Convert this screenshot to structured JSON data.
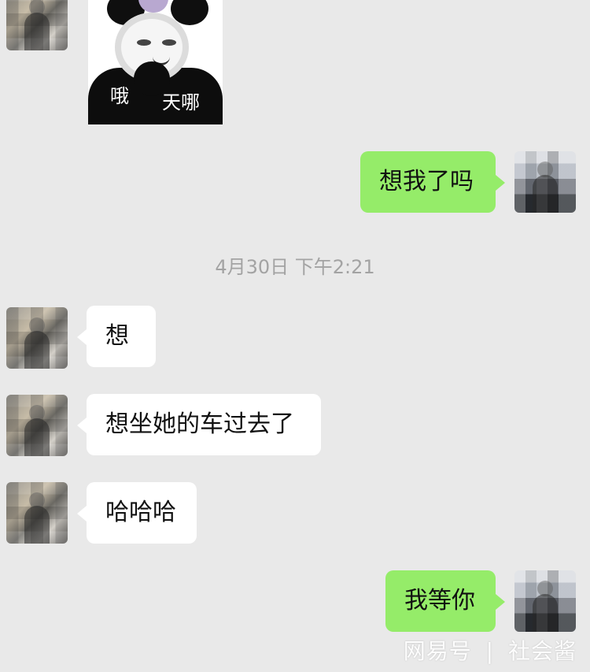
{
  "chat": {
    "messages": [
      {
        "side": "left",
        "kind": "sticker",
        "caption_left": "哦",
        "caption_right": "天哪"
      },
      {
        "side": "right",
        "kind": "text",
        "text": "想我了吗"
      },
      {
        "kind": "timestamp",
        "text": "4月30日 下午2:21"
      },
      {
        "side": "left",
        "kind": "text",
        "text": "想"
      },
      {
        "side": "left",
        "kind": "text",
        "text": "想坐她的车过去了"
      },
      {
        "side": "left",
        "kind": "text",
        "text": "哈哈哈"
      },
      {
        "side": "right",
        "kind": "text",
        "text": "我等你"
      }
    ]
  },
  "watermark": {
    "source": "网易号",
    "separator": "|",
    "author": "社会酱"
  },
  "colors": {
    "background": "#e9e9e9",
    "incoming_bubble": "#ffffff",
    "outgoing_bubble": "#95ec69",
    "timestamp": "#a3a3a3"
  },
  "icons": {
    "avatar_left": "user-avatar-icon",
    "avatar_right": "user-avatar-icon",
    "sticker": "panda-meme-icon"
  }
}
